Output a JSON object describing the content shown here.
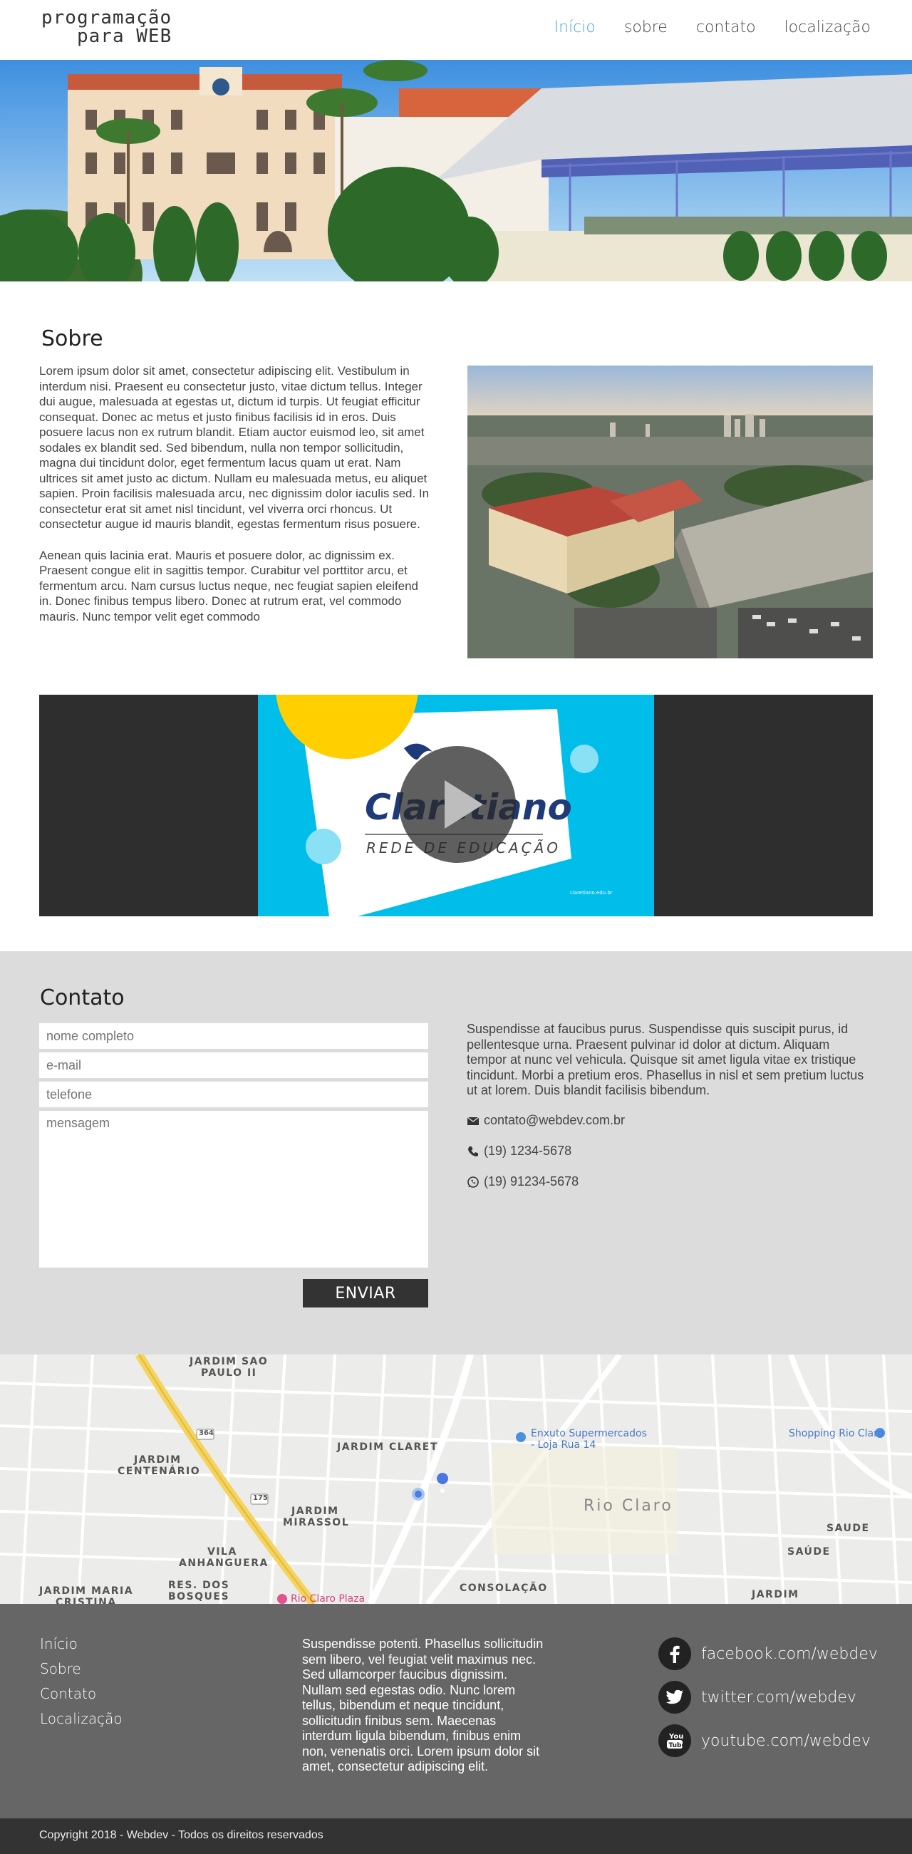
{
  "header": {
    "logo_line1": "programação",
    "logo_line2": "para WEB",
    "nav": [
      "Início",
      "sobre",
      "contato",
      "localização"
    ]
  },
  "sobre": {
    "title": "Sobre",
    "paragraph1": "Lorem ipsum dolor sit amet, consectetur adipiscing elit. Vestibulum in interdum nisi. Praesent eu consectetur justo, vitae dictum tellus. Integer dui augue, malesuada at egestas ut, dictum id turpis. Ut feugiat efficitur consequat. Donec ac metus et justo finibus facilisis id in eros. Duis posuere lacus non ex rutrum blandit. Etiam auctor euismod leo, sit amet sodales ex blandit sed. Sed bibendum, nulla non tempor sollicitudin, magna dui tincidunt dolor, eget fermentum lacus quam ut erat. Nam ultrices sit amet justo ac dictum. Nullam eu malesuada metus, eu aliquet sapien. Proin facilisis malesuada arcu, nec dignissim dolor iaculis sed. In consectetur erat sit amet nisl tincidunt, vel viverra orci rhoncus. Ut consectetur augue id mauris blandit, egestas fermentum risus posuere.",
    "paragraph2": "Aenean quis lacinia erat. Mauris et posuere dolor, ac dignissim ex. Praesent congue elit in sagittis tempor. Curabitur vel porttitor arcu, et fermentum arcu. Nam cursus luctus neque, nec feugiat sapien eleifend in. Donec finibus tempus libero. Donec at rutrum erat, vel commodo mauris. Nunc tempor velit eget commodo"
  },
  "video": {
    "brand": "Claretiano",
    "subtitle": "REDE DE EDUCAÇÃO",
    "site": "claretiano.edu.br"
  },
  "contato": {
    "title": "Contato",
    "placeholders": {
      "nome": "nome completo",
      "email": "e-mail",
      "telefone": "telefone",
      "mensagem": "mensagem"
    },
    "submit": "ENVIAR",
    "text": "Suspendisse at faucibus purus. Suspendisse quis suscipit purus, id pellentesque urna. Praesent pulvinar id dolor at dictum. Aliquam tempor at nunc vel vehicula. Quisque sit amet ligula vitae ex tristique tincidunt. Morbi a pretium eros. Phasellus in nisl et sem pretium luctus ut at lorem. Duis blandit facilisis bibendum.",
    "email": "contato@webdev.com.br",
    "phone": "(19) 1234-5678",
    "whatsapp": "(19) 91234-5678"
  },
  "map": {
    "labels": {
      "jardim_sao_paulo": "JARDIM SAO",
      "jardim_sao_paulo2": "PAULO II",
      "jardim_claret": "JARDIM CLARET",
      "jardim_centenario": "JARDIM",
      "jardim_centenario2": "CENTENÁRIO",
      "jardim_mirassol": "JARDIM",
      "jardim_mirassol2": "MIRASSOL",
      "vila_anhanguera": "VILA",
      "vila_anhanguera2": "ANHANGUERA",
      "jardim_maria": "JARDIM MARIA",
      "cristina": "CRISTINA",
      "res_dos_bosques": "RES. DOS",
      "res_dos_bosques2": "BOSQUES",
      "consolacao": "CONSOLAÇÃO",
      "rio_claro": "Rio Claro",
      "saude": "SAUDE",
      "saude2": "SAÚDE",
      "jardim": "JARDIM",
      "enxuto": "Enxuto Supermercados",
      "enxuto2": "- Loja Rua 14",
      "shopping": "Shopping Rio Claro",
      "plaza": "Rio Claro Plaza",
      "road": "364",
      "road2": "175"
    }
  },
  "footer": {
    "links": [
      "Início",
      "Sobre",
      "Contato",
      "Localização"
    ],
    "text": "Suspendisse potenti. Phasellus sollicitudin sem libero, vel feugiat velit maximus nec. Sed ullamcorper faucibus dignissim. Nullam sed egestas odio. Nunc lorem tellus, bibendum et neque tincidunt, sollicitudin finibus sem. Maecenas interdum ligula bibendum, finibus enim non, venenatis orci. Lorem ipsum dolor sit amet, consectetur adipiscing elit.",
    "social": {
      "facebook": "facebook.com/webdev",
      "twitter": "twitter.com/webdev",
      "youtube": "youtube.com/webdev"
    },
    "copyright": "Copyright 2018 - Webdev - Todos os direitos reservados"
  },
  "colors": {
    "accent": "#4aa3df",
    "contact_bg": "#dcdcdc",
    "footer_bg": "#666666",
    "copyright_bg": "#333333",
    "video_bg": "#2e2e2e",
    "claretiano_blue": "#00bde9",
    "claretiano_yellow": "#ffcf00"
  }
}
